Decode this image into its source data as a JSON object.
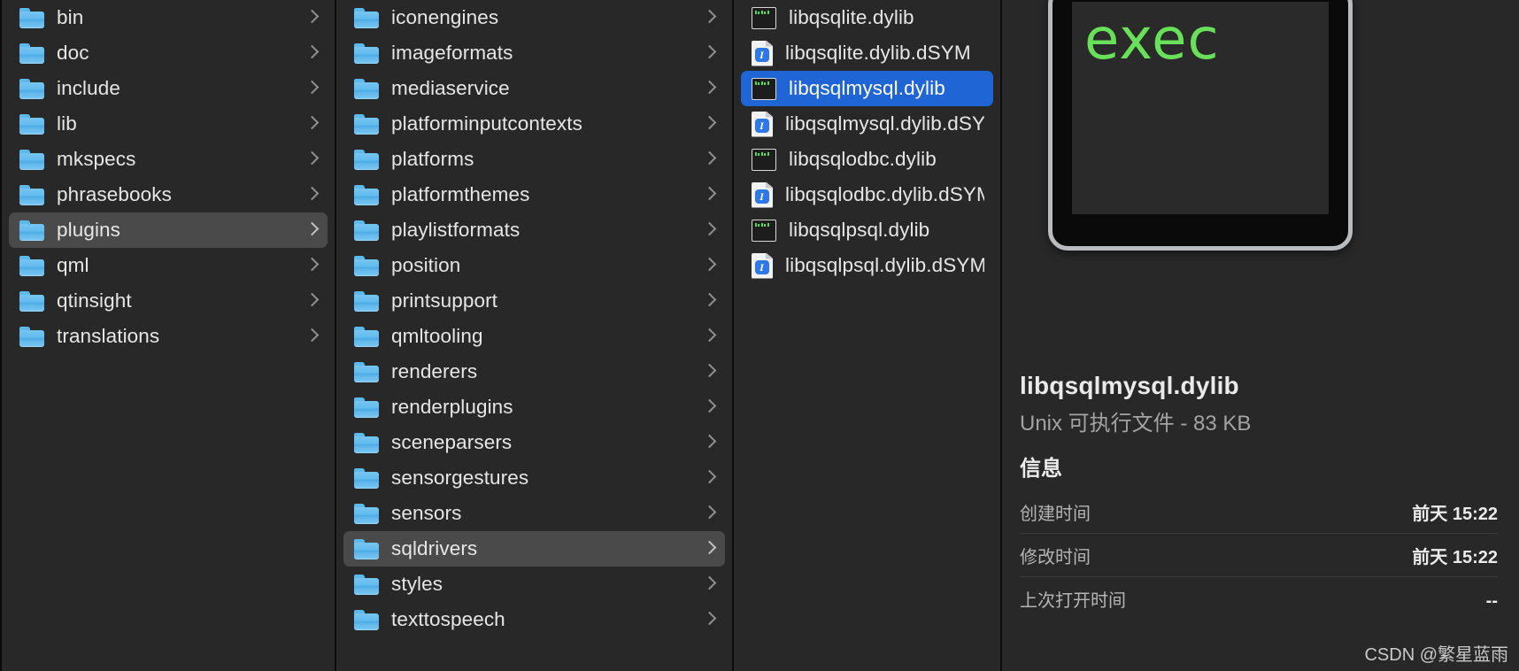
{
  "app": "finder-column-view",
  "colors": {
    "background": "#282828",
    "selection_active": "#1f65d6",
    "selection_inactive": "#4a4a4a",
    "divider": "#0b0b0b",
    "folder_blue": "#5fb8ec",
    "exec_green": "#69e05a"
  },
  "columns": [
    {
      "name": "column-qt-root",
      "items": [
        {
          "label": "bin",
          "icon": "folder-icon",
          "chevron": true,
          "selected": "none"
        },
        {
          "label": "doc",
          "icon": "folder-icon",
          "chevron": true,
          "selected": "none"
        },
        {
          "label": "include",
          "icon": "folder-icon",
          "chevron": true,
          "selected": "none"
        },
        {
          "label": "lib",
          "icon": "folder-icon",
          "chevron": true,
          "selected": "none"
        },
        {
          "label": "mkspecs",
          "icon": "folder-icon",
          "chevron": true,
          "selected": "none"
        },
        {
          "label": "phrasebooks",
          "icon": "folder-icon",
          "chevron": true,
          "selected": "none"
        },
        {
          "label": "plugins",
          "icon": "folder-icon",
          "chevron": true,
          "selected": "gray"
        },
        {
          "label": "qml",
          "icon": "folder-icon",
          "chevron": true,
          "selected": "none"
        },
        {
          "label": "qtinsight",
          "icon": "folder-icon",
          "chevron": true,
          "selected": "none"
        },
        {
          "label": "translations",
          "icon": "folder-icon",
          "chevron": true,
          "selected": "none"
        }
      ]
    },
    {
      "name": "column-plugins",
      "items": [
        {
          "label": "iconengines",
          "icon": "folder-icon",
          "chevron": true,
          "selected": "none"
        },
        {
          "label": "imageformats",
          "icon": "folder-icon",
          "chevron": true,
          "selected": "none"
        },
        {
          "label": "mediaservice",
          "icon": "folder-icon",
          "chevron": true,
          "selected": "none"
        },
        {
          "label": "platforminputcontexts",
          "icon": "folder-icon",
          "chevron": true,
          "selected": "none"
        },
        {
          "label": "platforms",
          "icon": "folder-icon",
          "chevron": true,
          "selected": "none"
        },
        {
          "label": "platformthemes",
          "icon": "folder-icon",
          "chevron": true,
          "selected": "none"
        },
        {
          "label": "playlistformats",
          "icon": "folder-icon",
          "chevron": true,
          "selected": "none"
        },
        {
          "label": "position",
          "icon": "folder-icon",
          "chevron": true,
          "selected": "none"
        },
        {
          "label": "printsupport",
          "icon": "folder-icon",
          "chevron": true,
          "selected": "none"
        },
        {
          "label": "qmltooling",
          "icon": "folder-icon",
          "chevron": true,
          "selected": "none"
        },
        {
          "label": "renderers",
          "icon": "folder-icon",
          "chevron": true,
          "selected": "none"
        },
        {
          "label": "renderplugins",
          "icon": "folder-icon",
          "chevron": true,
          "selected": "none"
        },
        {
          "label": "sceneparsers",
          "icon": "folder-icon",
          "chevron": true,
          "selected": "none"
        },
        {
          "label": "sensorgestures",
          "icon": "folder-icon",
          "chevron": true,
          "selected": "none"
        },
        {
          "label": "sensors",
          "icon": "folder-icon",
          "chevron": true,
          "selected": "none"
        },
        {
          "label": "sqldrivers",
          "icon": "folder-icon",
          "chevron": true,
          "selected": "gray"
        },
        {
          "label": "styles",
          "icon": "folder-icon",
          "chevron": true,
          "selected": "none"
        },
        {
          "label": "texttospeech",
          "icon": "folder-icon",
          "chevron": true,
          "selected": "none"
        }
      ]
    },
    {
      "name": "column-sqldrivers",
      "items": [
        {
          "label": "libqsqlite.dylib",
          "icon": "unix-executable-icon",
          "chevron": false,
          "selected": "none"
        },
        {
          "label": "libqsqlite.dylib.dSYM",
          "icon": "dsym-document-icon",
          "chevron": false,
          "selected": "none"
        },
        {
          "label": "libqsqlmysql.dylib",
          "icon": "unix-executable-icon",
          "chevron": false,
          "selected": "blue"
        },
        {
          "label": "libqsqlmysql.dylib.dSYM",
          "icon": "dsym-document-icon",
          "chevron": false,
          "selected": "none"
        },
        {
          "label": "libqsqlodbc.dylib",
          "icon": "unix-executable-icon",
          "chevron": false,
          "selected": "none"
        },
        {
          "label": "libqsqlodbc.dylib.dSYM",
          "icon": "dsym-document-icon",
          "chevron": false,
          "selected": "none"
        },
        {
          "label": "libqsqlpsql.dylib",
          "icon": "unix-executable-icon",
          "chevron": false,
          "selected": "none"
        },
        {
          "label": "libqsqlpsql.dylib.dSYM",
          "icon": "dsym-document-icon",
          "chevron": false,
          "selected": "none"
        }
      ]
    }
  ],
  "preview": {
    "icon_name": "unix-executable-large-icon",
    "icon_text": "exec",
    "file_name": "libqsqlmysql.dylib",
    "file_kind_and_size": "Unix 可执行文件 - 83 KB",
    "info_heading": "信息",
    "metadata": [
      {
        "key": "创建时间",
        "value": "前天 15:22"
      },
      {
        "key": "修改时间",
        "value": "前天 15:22"
      },
      {
        "key": "上次打开时间",
        "value": "--"
      }
    ]
  },
  "watermark": "CSDN @繁星蓝雨"
}
